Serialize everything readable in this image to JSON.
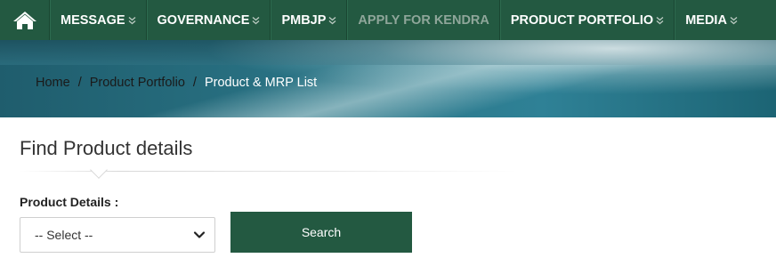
{
  "nav": {
    "items": [
      {
        "label": "MESSAGE",
        "has_dropdown": true,
        "enabled": true
      },
      {
        "label": "GOVERNANCE",
        "has_dropdown": true,
        "enabled": true
      },
      {
        "label": "PMBJP",
        "has_dropdown": true,
        "enabled": true
      },
      {
        "label": "APPLY FOR KENDRA",
        "has_dropdown": false,
        "enabled": false
      },
      {
        "label": "PRODUCT PORTFOLIO",
        "has_dropdown": true,
        "enabled": true
      },
      {
        "label": "MEDIA",
        "has_dropdown": true,
        "enabled": true
      }
    ],
    "home_icon": "home-icon",
    "dropdown_icon": "double-chevron-down-icon",
    "background_color": "#235941"
  },
  "breadcrumb": {
    "items": [
      "Home",
      "Product Portfolio",
      "Product & MRP List"
    ],
    "separator": "/"
  },
  "content": {
    "heading": "Find Product details",
    "field_label": "Product Details :",
    "select": {
      "selected": "-- Select --"
    },
    "search_label": "Search"
  },
  "colors": {
    "accent": "#235941",
    "banner": "#2b7688"
  }
}
